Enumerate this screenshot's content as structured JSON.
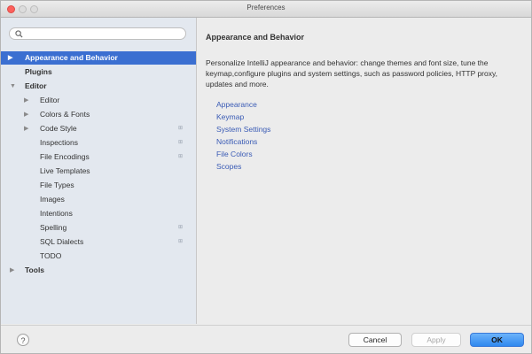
{
  "window": {
    "title": "Preferences"
  },
  "search": {
    "placeholder": "",
    "value": ""
  },
  "tree": {
    "items": [
      {
        "label": "Appearance and Behavior",
        "selected": true,
        "arrow": "▶"
      },
      {
        "label": "Plugins"
      },
      {
        "label": "Editor",
        "arrow": "▼"
      },
      {
        "label": "Editor",
        "arrow": "▶"
      },
      {
        "label": "Colors & Fonts",
        "arrow": "▶"
      },
      {
        "label": "Code Style",
        "arrow": "▶",
        "marker": "⊞"
      },
      {
        "label": "Inspections",
        "marker": "⊞"
      },
      {
        "label": "File Encodings",
        "marker": "⊞"
      },
      {
        "label": "Live Templates"
      },
      {
        "label": "File Types"
      },
      {
        "label": "Images"
      },
      {
        "label": "Intentions"
      },
      {
        "label": "Spelling",
        "marker": "⊞"
      },
      {
        "label": "SQL Dialects",
        "marker": "⊞"
      },
      {
        "label": "TODO"
      },
      {
        "label": "Tools",
        "arrow": "▶"
      }
    ]
  },
  "content": {
    "heading": "Appearance and Behavior",
    "description": "Personalize IntelliJ appearance and behavior: change themes and font size, tune the keymap,configure plugins and system settings, such as password policies, HTTP proxy, updates and more.",
    "links": [
      "Appearance",
      "Keymap",
      "System Settings",
      "Notifications",
      "File Colors",
      "Scopes"
    ]
  },
  "footer": {
    "help_label": "?",
    "cancel_label": "Cancel",
    "apply_label": "Apply",
    "ok_label": "OK"
  },
  "colors": {
    "selection": "#3b6fd1",
    "link": "#3a5bb5",
    "ok_button": "#2f88ef"
  }
}
